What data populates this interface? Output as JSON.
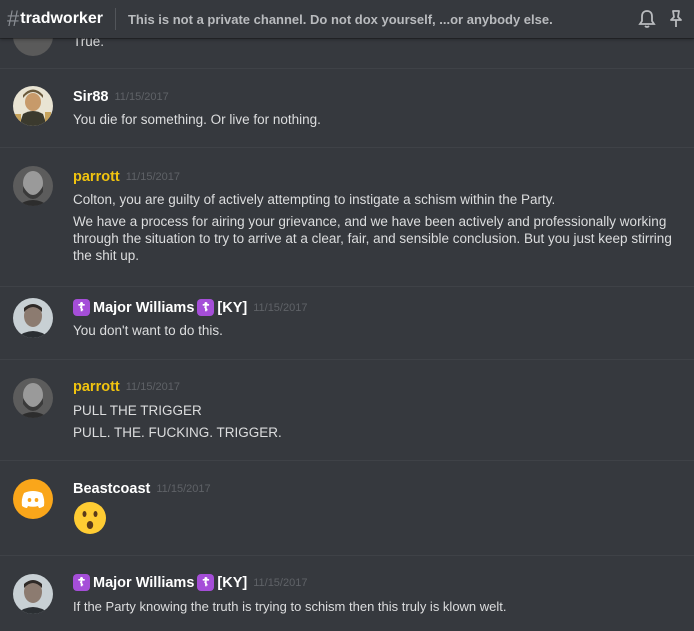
{
  "header": {
    "hash": "#",
    "channel": "tradworker",
    "topic": "This is not a private channel. Do not dox yourself, ...or anybody else.",
    "icons": [
      "bell-icon",
      "pin-icon"
    ]
  },
  "scroll_top": {
    "text": "True."
  },
  "messages": [
    {
      "author": "Sir88",
      "author_color": "#ffffff",
      "timestamp": "11/15/2017",
      "avatar": "portrait-avatar",
      "lines": [
        "You die for something. Or live for nothing."
      ]
    },
    {
      "author": "parrott",
      "author_color": "#f1c40f",
      "timestamp": "11/15/2017",
      "avatar": "bearded-man-avatar",
      "lines": [
        "Colton, you are guilty of actively attempting to instigate a schism within the Party.",
        "We have a process for airing your grievance, and we have been actively and professionally working through the situation to try to arrive at a clear, fair, and sensible conclusion. But you just keep stirring the shit up."
      ]
    },
    {
      "author": "Major Williams",
      "author_suffix": "[KY]",
      "author_color": "#ffffff",
      "timestamp": "11/15/2017",
      "avatar": "man-avatar",
      "lines": [
        "You don't want to do this."
      ]
    },
    {
      "author": "parrott",
      "author_color": "#f1c40f",
      "timestamp": "11/15/2017",
      "avatar": "bearded-man-avatar",
      "lines": [
        "PULL THE TRIGGER",
        "PULL. THE. FUCKING. TRIGGER."
      ]
    },
    {
      "author": "Beastcoast",
      "author_color": "#ffffff",
      "timestamp": "11/15/2017",
      "avatar": "discord-default-avatar",
      "lines": [
        "😮"
      ]
    },
    {
      "author": "Major Williams",
      "author_suffix": "[KY]",
      "author_color": "#ffffff",
      "timestamp": "11/15/2017",
      "avatar": "man-avatar",
      "lines": [
        "If the Party knowing the truth is trying to schism then this truly is klown welt."
      ]
    }
  ],
  "colors": {
    "background": "#36393e",
    "separator": "#3f4247",
    "accent_yellow": "#f1c40f",
    "badge_purple": "#a54ed8",
    "discord_avatar": "#faa61a"
  }
}
